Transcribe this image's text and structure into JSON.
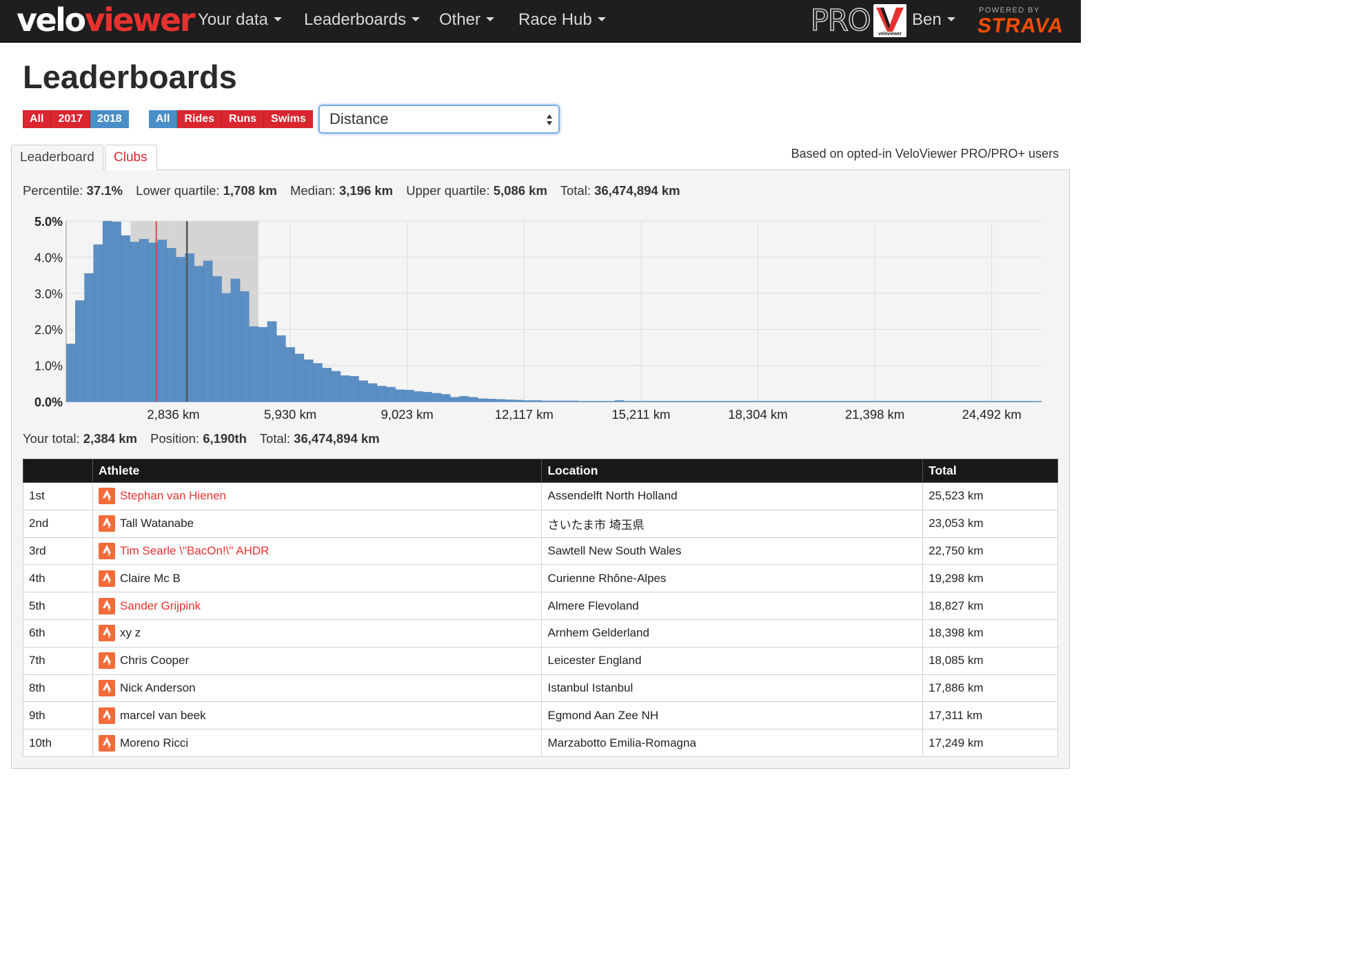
{
  "nav": {
    "brand_part1": "velo",
    "brand_part2": "viewer",
    "items": [
      {
        "label": "Your data"
      },
      {
        "label": "Leaderboards"
      },
      {
        "label": "Other"
      },
      {
        "label": "Race Hub"
      }
    ],
    "pro_label": "PRO",
    "logo_caption": "veloviewer",
    "user_name": "Ben",
    "powered_by": "POWERED BY",
    "strava": "STRAVA"
  },
  "page": {
    "title": "Leaderboards",
    "year_filter": [
      "All",
      "2017",
      "2018"
    ],
    "year_selected": "2018",
    "type_filter": [
      "All",
      "Rides",
      "Runs",
      "Swims"
    ],
    "type_selected": "All",
    "metric_select": {
      "value": "Distance"
    },
    "tabs": [
      "Leaderboard",
      "Clubs"
    ],
    "active_tab": "Leaderboard",
    "based_on": "Based on opted-in VeloViewer PRO/PRO+ users"
  },
  "stats": {
    "percentile_label": "Percentile:",
    "percentile": "37.1%",
    "lower_q_label": "Lower quartile:",
    "lower_q": "1,708 km",
    "median_label": "Median:",
    "median": "3,196 km",
    "upper_q_label": "Upper quartile:",
    "upper_q": "5,086 km",
    "total_label": "Total:",
    "total": "36,474,894 km"
  },
  "your_stats": {
    "your_total_label": "Your total:",
    "your_total": "2,384 km",
    "position_label": "Position:",
    "position": "6,190th",
    "total_label": "Total:",
    "total": "36,474,894 km"
  },
  "colors": {
    "bar": "#5b8fc4",
    "bar_stroke": "#4a7eb3",
    "quartile_band": "#d4d4d4",
    "your_line": "#e0434a",
    "median_line": "#555555",
    "accent_red": "#d9262f",
    "accent_blue": "#4a8ec7"
  },
  "chart_data": {
    "type": "bar",
    "x_unit": "km",
    "bin_width_km": 242,
    "x_start_km": 0,
    "x_ticks": [
      2836,
      5930,
      9023,
      12117,
      15211,
      18304,
      21398,
      24492
    ],
    "x_tick_labels": [
      "2,836 km",
      "5,930 km",
      "9,023 km",
      "12,117 km",
      "15,211 km",
      "18,304 km",
      "21,398 km",
      "24,492 km"
    ],
    "y_tick_labels": [
      "5.0%",
      "4.0%",
      "3.0%",
      "2.0%",
      "1.0%",
      "0.0%"
    ],
    "y_ticks": [
      5,
      4,
      3,
      2,
      1,
      0
    ],
    "ylim": [
      0,
      5
    ],
    "y_unit": "%",
    "values": [
      1.6,
      2.8,
      3.55,
      4.35,
      5.0,
      4.98,
      4.6,
      4.42,
      4.5,
      4.4,
      4.48,
      4.25,
      4.0,
      4.1,
      3.75,
      3.9,
      3.47,
      3.0,
      3.4,
      3.05,
      2.08,
      2.06,
      2.22,
      1.83,
      1.5,
      1.32,
      1.16,
      1.06,
      0.93,
      0.84,
      0.72,
      0.7,
      0.58,
      0.5,
      0.43,
      0.4,
      0.33,
      0.32,
      0.28,
      0.26,
      0.23,
      0.2,
      0.12,
      0.15,
      0.12,
      0.08,
      0.07,
      0.06,
      0.05,
      0.04,
      0.03,
      0.03,
      0.02,
      0.02,
      0.02,
      0.02,
      0.01,
      0.01,
      0.01,
      0.01,
      0.03,
      0.01,
      0.01,
      0.01,
      0.01,
      0.01,
      0.01,
      0.01,
      0.01,
      0.01,
      0.01,
      0.01,
      0.01,
      0.01,
      0.01,
      0.01,
      0.01,
      0.01,
      0.01,
      0.01,
      0.01,
      0.01,
      0.01,
      0.01,
      0.01,
      0.01,
      0.01,
      0.01,
      0.01,
      0.01,
      0.01,
      0.01,
      0.01,
      0.01,
      0.01,
      0.01,
      0.01,
      0.01,
      0.01,
      0.01,
      0.01,
      0.01,
      0.01,
      0.01,
      0.01,
      0.01,
      0.01
    ],
    "lower_quartile_km": 1708,
    "median_km": 3196,
    "upper_quartile_km": 5086,
    "your_total_km": 2384,
    "grid": true
  },
  "table": {
    "headers": [
      "",
      "Athlete",
      "Location",
      "Total"
    ],
    "rows": [
      {
        "rank": "1st",
        "athlete": "Stephan van Hienen",
        "link": true,
        "location": "Assendelft North Holland",
        "total": "25,523 km"
      },
      {
        "rank": "2nd",
        "athlete": "Tall Watanabe",
        "link": false,
        "location": "さいたま市 埼玉県",
        "total": "23,053 km"
      },
      {
        "rank": "3rd",
        "athlete": "Tim Searle \\\"BacOn!\\\" AHDR",
        "link": true,
        "location": "Sawtell New South Wales",
        "total": "22,750 km"
      },
      {
        "rank": "4th",
        "athlete": "Claire Mc B",
        "link": false,
        "location": "Curienne Rhône-Alpes",
        "total": "19,298 km"
      },
      {
        "rank": "5th",
        "athlete": "Sander Grijpink",
        "link": true,
        "location": "Almere Flevoland",
        "total": "18,827 km"
      },
      {
        "rank": "6th",
        "athlete": "xy z",
        "link": false,
        "location": "Arnhem Gelderland",
        "total": "18,398 km"
      },
      {
        "rank": "7th",
        "athlete": "Chris Cooper",
        "link": false,
        "location": "Leicester England",
        "total": "18,085 km"
      },
      {
        "rank": "8th",
        "athlete": "Nick Anderson",
        "link": false,
        "location": "Istanbul Istanbul",
        "total": "17,886 km"
      },
      {
        "rank": "9th",
        "athlete": "marcel van beek",
        "link": false,
        "location": "Egmond Aan Zee NH",
        "total": "17,311 km"
      },
      {
        "rank": "10th",
        "athlete": "Moreno Ricci",
        "link": false,
        "location": "Marzabotto Emilia-Romagna",
        "total": "17,249 km"
      }
    ]
  }
}
